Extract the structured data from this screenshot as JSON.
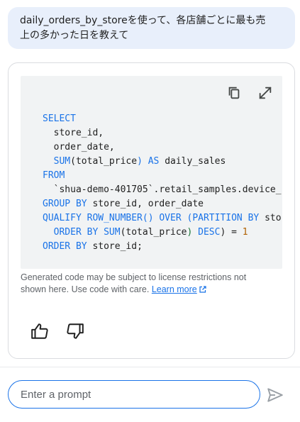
{
  "user_message": {
    "line1": "daily_orders_by_storeを使って、各店舗ごとに最も売",
    "line2": "上の多かった日を教えて"
  },
  "code": {
    "lines": [
      {
        "parts": [
          {
            "t": "SELECT",
            "c": "kw"
          }
        ]
      },
      {
        "parts": [
          {
            "t": "  store_id,",
            "c": ""
          }
        ]
      },
      {
        "parts": [
          {
            "t": "  order_date,",
            "c": ""
          }
        ]
      },
      {
        "parts": [
          {
            "t": "  ",
            "c": ""
          },
          {
            "t": "SUM",
            "c": "fn"
          },
          {
            "t": "(total_price",
            "c": ""
          },
          {
            "t": ")",
            "c": "fn"
          },
          {
            "t": " ",
            "c": ""
          },
          {
            "t": "AS",
            "c": "kw"
          },
          {
            "t": " daily_sales",
            "c": ""
          }
        ]
      },
      {
        "parts": [
          {
            "t": "FROM",
            "c": "kw"
          }
        ]
      },
      {
        "parts": [
          {
            "t": "  `shua-demo-401705`.retail_samples.device_",
            "c": ""
          }
        ]
      },
      {
        "parts": [
          {
            "t": "GROUP BY",
            "c": "kw"
          },
          {
            "t": " store_id, order_date",
            "c": ""
          }
        ]
      },
      {
        "parts": [
          {
            "t": "QUALIFY ROW_NUMBER() OVER (PARTITION BY",
            "c": "kw"
          },
          {
            "t": " sto",
            "c": ""
          }
        ]
      },
      {
        "parts": [
          {
            "t": "  ",
            "c": ""
          },
          {
            "t": "ORDER BY SUM",
            "c": "kw"
          },
          {
            "t": "(total_price",
            "c": ""
          },
          {
            "t": ")",
            "c": "paren"
          },
          {
            "t": " ",
            "c": ""
          },
          {
            "t": "DESC",
            "c": "kw"
          },
          {
            "t": ") = ",
            "c": ""
          },
          {
            "t": "1",
            "c": "num"
          }
        ]
      },
      {
        "parts": [
          {
            "t": "ORDER BY",
            "c": "kw"
          },
          {
            "t": " store_id;",
            "c": ""
          }
        ]
      }
    ]
  },
  "disclaimer": {
    "text_line1": "Generated code may be subject to license restrictions not",
    "text_line2": "shown here. Use code with care.",
    "link_label": "Learn more"
  },
  "prompt": {
    "placeholder": "Enter a prompt"
  },
  "icons": {
    "copy": "copy-icon",
    "expand": "expand-icon",
    "thumbs_up": "thumbs-up-icon",
    "thumbs_down": "thumbs-down-icon",
    "external_link": "external-link-icon",
    "send": "send-icon"
  },
  "colors": {
    "keyword": "#1a73e8",
    "number": "#b06000",
    "paren": "#137333",
    "link": "#1a73e8",
    "bubble_bg": "#e8effb",
    "code_bg": "#f1f3f4",
    "input_border": "#1a73e8"
  }
}
